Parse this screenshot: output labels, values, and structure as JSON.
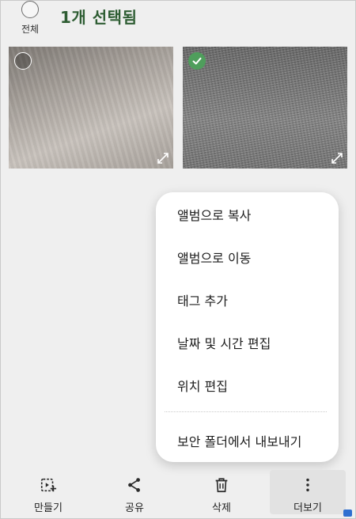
{
  "header": {
    "select_all_label": "전체",
    "title": "1개 선택됨"
  },
  "photos": [
    {
      "selected": false,
      "expand_icon": "expand-icon"
    },
    {
      "selected": true,
      "expand_icon": "expand-icon"
    }
  ],
  "menu": {
    "items": [
      "앨범으로 복사",
      "앨범으로 이동",
      "태그 추가",
      "날짜 및 시간 편집",
      "위치 편집",
      "보안 폴더에서 내보내기"
    ]
  },
  "bottom_bar": {
    "items": [
      {
        "label": "만들기",
        "icon": "create-icon"
      },
      {
        "label": "공유",
        "icon": "share-icon"
      },
      {
        "label": "삭제",
        "icon": "trash-icon"
      },
      {
        "label": "더보기",
        "icon": "more-vertical-icon"
      }
    ]
  },
  "colors": {
    "accent_green": "#4f9e5c",
    "title_green": "#2e5d33",
    "background": "#efefef"
  }
}
